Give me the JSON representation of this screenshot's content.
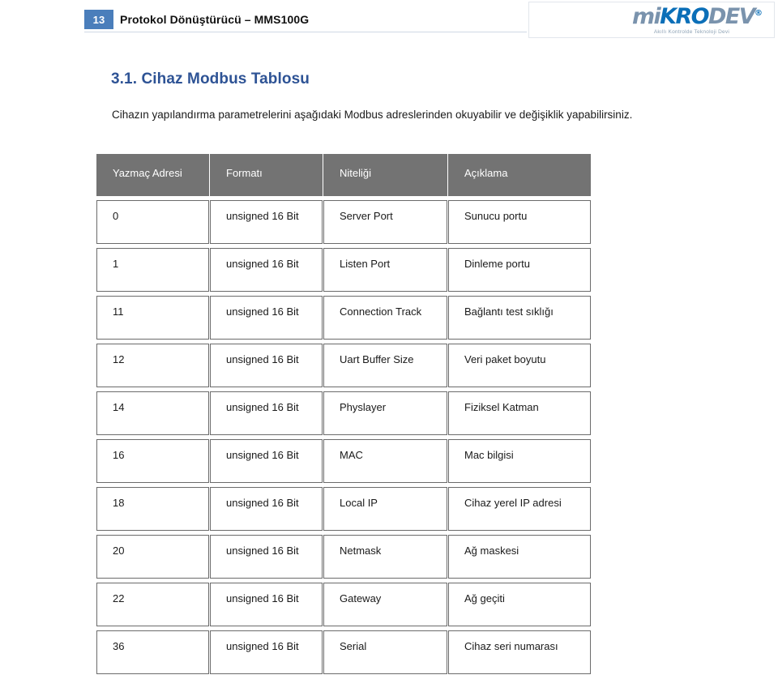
{
  "header": {
    "page_number": "13",
    "title": "Protokol Dönüştürücü – MMS100G",
    "logo": {
      "word_part_1": "mi",
      "word_part_2": "KRO",
      "word_part_3": "DEV",
      "registered_mark": "®",
      "tagline": "Akıllı Kontrolde Teknoloji Devi"
    }
  },
  "section": {
    "title": "3.1. Cihaz Modbus Tablosu",
    "intro": "Cihazın yapılandırma parametrelerini aşağıdaki Modbus adreslerinden okuyabilir ve değişiklik yapabilirsiniz."
  },
  "table": {
    "headers": [
      "Yazmaç Adresi",
      "Formatı",
      "Niteliği",
      "Açıklama"
    ],
    "rows": [
      {
        "address": "0",
        "format": "unsigned 16 Bit",
        "attribute": "Server Port",
        "description": "Sunucu portu"
      },
      {
        "address": "1",
        "format": "unsigned 16 Bit",
        "attribute": "Listen Port",
        "description": "Dinleme portu"
      },
      {
        "address": "11",
        "format": "unsigned 16 Bit",
        "attribute": "Connection Track",
        "description": "Bağlantı test sıklığı"
      },
      {
        "address": "12",
        "format": "unsigned 16 Bit",
        "attribute": "Uart Buffer Size",
        "description": "Veri paket boyutu"
      },
      {
        "address": "14",
        "format": "unsigned 16 Bit",
        "attribute": "Physlayer",
        "description": "Fiziksel Katman"
      },
      {
        "address": "16",
        "format": "unsigned 16 Bit",
        "attribute": "MAC",
        "description": "Mac bilgisi"
      },
      {
        "address": "18",
        "format": "unsigned 16 Bit",
        "attribute": "Local IP",
        "description": "Cihaz yerel IP adresi"
      },
      {
        "address": "20",
        "format": "unsigned 16 Bit",
        "attribute": "Netmask",
        "description": "Ağ maskesi"
      },
      {
        "address": "22",
        "format": "unsigned 16 Bit",
        "attribute": "Gateway",
        "description": "Ağ geçiti"
      },
      {
        "address": "36",
        "format": "unsigned 16 Bit",
        "attribute": "Serial",
        "description": "Cihaz seri numarası"
      }
    ]
  },
  "colors": {
    "badge_blue": "#4a7ebb",
    "title_blue": "#2e5395",
    "table_header_gray": "#737373",
    "logo_blue": "#0b6fb8",
    "logo_gray_blue": "#7a93ad"
  }
}
